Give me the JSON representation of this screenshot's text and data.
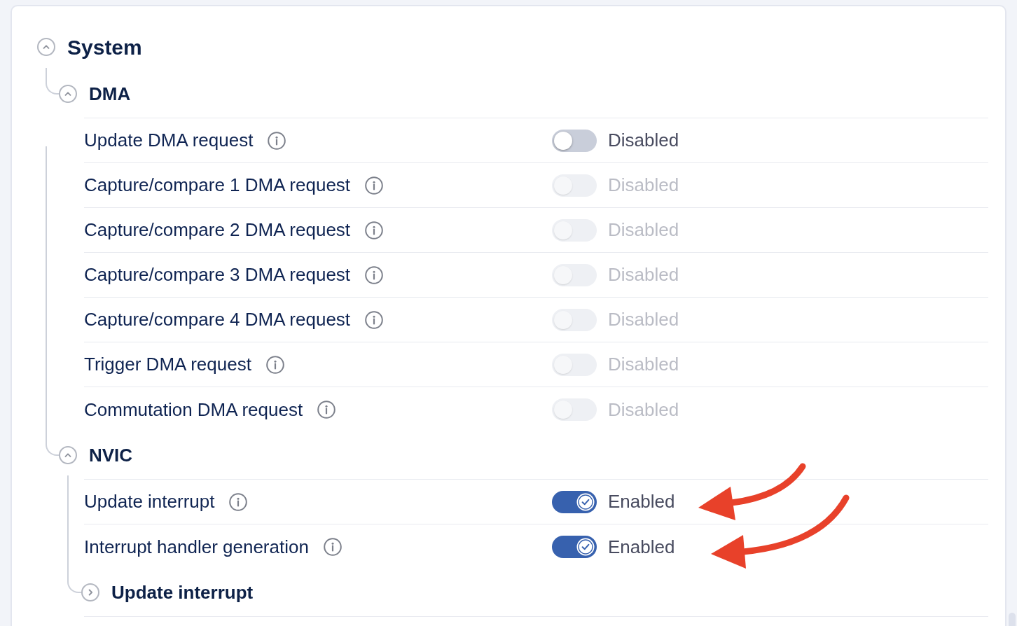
{
  "tree": [
    {
      "title": "System",
      "expanded": true,
      "children": [
        {
          "title": "DMA",
          "expanded": true,
          "settings": [
            {
              "label": "Update DMA request",
              "on": false,
              "disabled": false,
              "status": "Disabled"
            },
            {
              "label": "Capture/compare 1 DMA request",
              "on": false,
              "disabled": true,
              "status": "Disabled"
            },
            {
              "label": "Capture/compare 2 DMA request",
              "on": false,
              "disabled": true,
              "status": "Disabled"
            },
            {
              "label": "Capture/compare 3 DMA request",
              "on": false,
              "disabled": true,
              "status": "Disabled"
            },
            {
              "label": "Capture/compare 4 DMA request",
              "on": false,
              "disabled": true,
              "status": "Disabled"
            },
            {
              "label": "Trigger DMA request",
              "on": false,
              "disabled": true,
              "status": "Disabled"
            },
            {
              "label": "Commutation DMA request",
              "on": false,
              "disabled": true,
              "status": "Disabled"
            }
          ]
        },
        {
          "title": "NVIC",
          "expanded": true,
          "settings": [
            {
              "label": "Update interrupt",
              "on": true,
              "disabled": false,
              "status": "Enabled"
            },
            {
              "label": "Interrupt handler generation",
              "on": true,
              "disabled": false,
              "status": "Enabled"
            }
          ],
          "children": [
            {
              "title": "Update interrupt",
              "expanded": false
            }
          ]
        }
      ]
    }
  ]
}
